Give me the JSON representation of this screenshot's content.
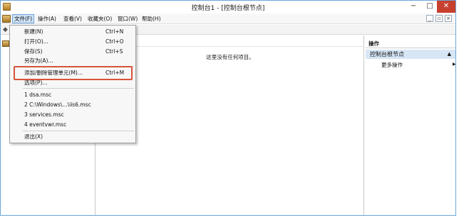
{
  "window": {
    "title": "控制台1 - [控制台根节点]",
    "min": "−",
    "max": "□",
    "close": "✕"
  },
  "menubar": {
    "items": [
      "文件(F)",
      "操作(A)",
      "查看(V)",
      "收藏夹(O)",
      "窗口(W)",
      "帮助(H)"
    ],
    "mdi": [
      "_",
      "▫",
      "×"
    ]
  },
  "toolbar": {
    "back": "◆"
  },
  "file_menu": {
    "items": [
      {
        "label": "新建(N)",
        "shortcut": "Ctrl+N"
      },
      {
        "label": "打开(O)...",
        "shortcut": "Ctrl+O"
      },
      {
        "label": "保存(S)",
        "shortcut": "Ctrl+S"
      },
      {
        "label": "另存为(A)...",
        "shortcut": ""
      },
      {
        "label": "添加/删除管理单元(M)...",
        "shortcut": "Ctrl+M"
      },
      {
        "label": "选项(P)...",
        "shortcut": ""
      },
      {
        "label": "1 dsa.msc",
        "shortcut": ""
      },
      {
        "label": "2 C:\\Windows\\...\\iis6.msc",
        "shortcut": ""
      },
      {
        "label": "3 services.msc",
        "shortcut": ""
      },
      {
        "label": "4 eventvwr.msc",
        "shortcut": ""
      },
      {
        "label": "退出(X)",
        "shortcut": ""
      }
    ]
  },
  "center": {
    "empty_message": "这里没有任何项目。"
  },
  "actions": {
    "header": "操作",
    "section": "控制台根节点",
    "section_caret": "▲",
    "more": "更多操作",
    "more_caret": "▶"
  },
  "colors": {
    "highlight_border": "#d9533c",
    "section_bg": "#d7e6f5",
    "close_button": "#c7402f"
  }
}
